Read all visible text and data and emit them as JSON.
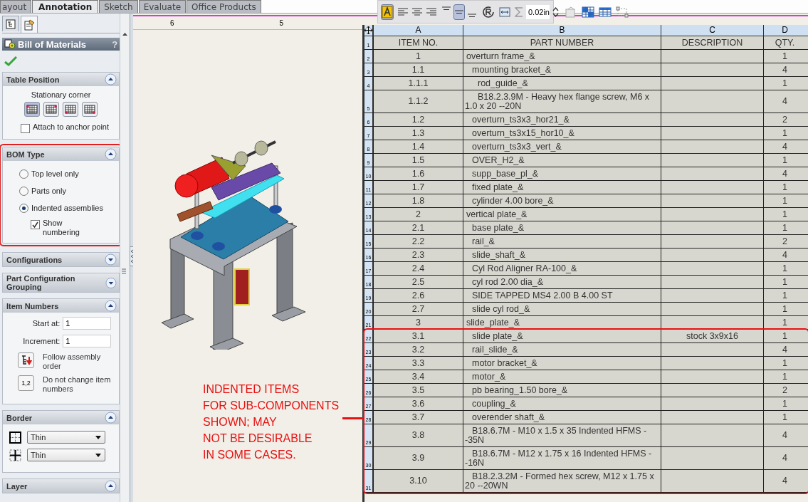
{
  "tabs": [
    {
      "label": "ayout",
      "selected": false
    },
    {
      "label": "Annotation",
      "selected": true
    },
    {
      "label": "Sketch",
      "selected": false
    },
    {
      "label": "Evaluate",
      "selected": false
    },
    {
      "label": "Office Products",
      "selected": false
    }
  ],
  "toolbar": {
    "font_pressed": true,
    "halign": [
      {
        "selected": false
      },
      {
        "selected": false
      },
      {
        "selected": false
      }
    ],
    "valign": [
      {
        "selected": false
      },
      {
        "selected": true
      },
      {
        "selected": false
      }
    ],
    "spacing": "0.02in"
  },
  "panel": {
    "tabs": [
      {
        "selected": false
      },
      {
        "selected": true
      }
    ],
    "title": "Bill of Materials",
    "help": "?",
    "sections": [
      {
        "kind": "table_position",
        "title": "Table Position",
        "expanded": true,
        "label": "Stationary corner",
        "corners": [
          {
            "selected": true
          },
          {
            "selected": false
          },
          {
            "selected": false
          },
          {
            "selected": false
          }
        ],
        "attach": {
          "label": "Attach to anchor point",
          "checked": false
        }
      },
      {
        "kind": "bom_type",
        "title": "BOM Type",
        "expanded": true,
        "highlighted": true,
        "options": [
          {
            "label": "Top level only",
            "selected": false
          },
          {
            "label": "Parts only",
            "selected": false
          },
          {
            "label": "Indented assemblies",
            "selected": true
          }
        ],
        "numbering": {
          "label": "Show numbering",
          "checked": true
        }
      },
      {
        "kind": "header",
        "title": "Configurations",
        "expanded": false
      },
      {
        "kind": "header",
        "title": "Part Configuration Grouping",
        "expanded": false
      },
      {
        "kind": "item_numbers",
        "title": "Item Numbers",
        "expanded": true,
        "start_label": "Start at:",
        "start": "1",
        "increment_label": "Increment:",
        "increment": "1",
        "follow": "Follow assembly order",
        "keep_button": "1,2",
        "keep": "Do not change item numbers"
      },
      {
        "kind": "border",
        "title": "Border",
        "expanded": true,
        "box": "Thin",
        "grid": "Thin"
      },
      {
        "kind": "header",
        "title": "Layer",
        "expanded": true
      }
    ]
  },
  "sheet": {
    "ruler": [
      "6",
      "5"
    ],
    "callout": [
      "INDENTED ITEMS",
      "FOR SUB-COMPONENTS",
      "SHOWN; MAY",
      "NOT BE DESIRABLE",
      "IN SOME CASES."
    ]
  },
  "table": {
    "letters": [
      "A",
      "B",
      "C",
      "D"
    ],
    "header_row": "1",
    "columns": [
      "ITEM NO.",
      "PART NUMBER",
      "DESCRIPTION",
      "QTY."
    ],
    "rows": [
      {
        "row": "2",
        "item": "1",
        "part": "overturn frame_&",
        "qty": "1",
        "children": [
          {
            "row": "3",
            "item": "1.1",
            "part": "mounting bracket_&",
            "qty": "4",
            "children": [
              {
                "row": "4",
                "item": "1.1.1",
                "part": "rod_guide_&",
                "qty": "1"
              },
              {
                "row": "5",
                "item": "1.1.2",
                "part": "B18.2.3.9M - Heavy hex flange screw, M6 x 1.0 x 20 --20N",
                "qty": "4"
              }
            ]
          },
          {
            "row": "6",
            "item": "1.2",
            "part": "overturn_ts3x3_hor21_&",
            "qty": "2"
          },
          {
            "row": "7",
            "item": "1.3",
            "part": "overturn_ts3x15_hor10_&",
            "qty": "1"
          },
          {
            "row": "8",
            "item": "1.4",
            "part": "overturn_ts3x3_vert_&",
            "qty": "4"
          },
          {
            "row": "9",
            "item": "1.5",
            "part": "OVER_H2_&",
            "qty": "1"
          },
          {
            "row": "10",
            "item": "1.6",
            "part": "supp_base_pl_&",
            "qty": "4"
          },
          {
            "row": "11",
            "item": "1.7",
            "part": "fixed plate_&",
            "qty": "1"
          },
          {
            "row": "12",
            "item": "1.8",
            "part": "cylinder 4.00 bore_&",
            "qty": "1"
          }
        ]
      },
      {
        "row": "13",
        "item": "2",
        "part": "vertical plate_&",
        "qty": "1",
        "children": [
          {
            "row": "14",
            "item": "2.1",
            "part": "base plate_&",
            "qty": "1"
          },
          {
            "row": "15",
            "item": "2.2",
            "part": "rail_&",
            "qty": "2"
          },
          {
            "row": "16",
            "item": "2.3",
            "part": "slide_shaft_&",
            "qty": "4"
          },
          {
            "row": "17",
            "item": "2.4",
            "part": "Cyl Rod Aligner RA-100_&",
            "qty": "1"
          },
          {
            "row": "18",
            "item": "2.5",
            "part": "cyl rod 2.00 dia_&",
            "qty": "1"
          },
          {
            "row": "19",
            "item": "2.6",
            "part": "SIDE TAPPED MS4 2.00 B 4.00 ST",
            "qty": "1"
          },
          {
            "row": "20",
            "item": "2.7",
            "part": "slide cyl rod_&",
            "qty": "1"
          }
        ]
      },
      {
        "row": "21",
        "item": "3",
        "part": "slide_plate_&",
        "qty": "1",
        "children_boxed": true,
        "children": [
          {
            "row": "22",
            "item": "3.1",
            "part": "slide plate_&",
            "description": "stock 3x9x16",
            "qty": "1"
          },
          {
            "row": "23",
            "item": "3.2",
            "part": "rail_slide_&",
            "qty": "4"
          },
          {
            "row": "24",
            "item": "3.3",
            "part": "motor bracket_&",
            "qty": "1"
          },
          {
            "row": "25",
            "item": "3.4",
            "part": "motor_&",
            "qty": "1"
          },
          {
            "row": "26",
            "item": "3.5",
            "part": "pb bearing_1.50 bore_&",
            "qty": "2"
          },
          {
            "row": "27",
            "item": "3.6",
            "part": "coupling_&",
            "qty": "1"
          },
          {
            "row": "28",
            "item": "3.7",
            "part": "overender shaft_&",
            "qty": "1"
          },
          {
            "row": "29",
            "item": "3.8",
            "part": "B18.6.7M - M10 x 1.5 x 35 Indented HFMS --35N",
            "qty": "4"
          },
          {
            "row": "30",
            "item": "3.9",
            "part": "B18.6.7M - M12 x 1.75 x 16 Indented HFMS --16N",
            "qty": "4"
          },
          {
            "row": "31",
            "item": "3.10",
            "part": "B18.2.3.2M - Formed hex screw, M12 x 1.75 x 20 --20WN",
            "qty": "4"
          }
        ]
      }
    ]
  }
}
